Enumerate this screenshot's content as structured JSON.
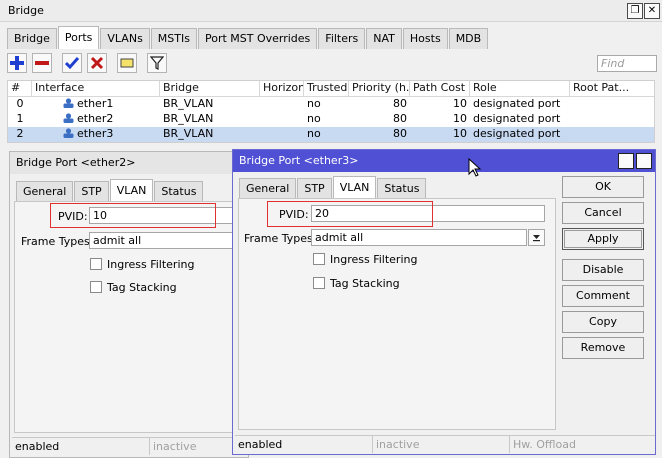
{
  "window": {
    "title": "Bridge",
    "restore_glyph": "❐",
    "close_glyph": "✕"
  },
  "main_tabs": [
    "Bridge",
    "Ports",
    "VLANs",
    "MSTIs",
    "Port MST Overrides",
    "Filters",
    "NAT",
    "Hosts",
    "MDB"
  ],
  "active_main_tab": "Ports",
  "toolbar": {
    "find_placeholder": "Find"
  },
  "table": {
    "headers": [
      "#",
      "Interface",
      "Bridge",
      "Horizon",
      "Trusted",
      "Priority (h...",
      "Path Cost",
      "Role",
      "Root Pat..."
    ],
    "rows": [
      {
        "num": "0",
        "iface": "ether1",
        "bridge": "BR_VLAN",
        "horizon": "",
        "trusted": "no",
        "priority": "80",
        "cost": "10",
        "role": "designated port",
        "root": ""
      },
      {
        "num": "1",
        "iface": "ether2",
        "bridge": "BR_VLAN",
        "horizon": "",
        "trusted": "no",
        "priority": "80",
        "cost": "10",
        "role": "designated port",
        "root": ""
      },
      {
        "num": "2",
        "iface": "ether3",
        "bridge": "BR_VLAN",
        "horizon": "",
        "trusted": "no",
        "priority": "80",
        "cost": "10",
        "role": "designated port",
        "root": ""
      }
    ],
    "selected_row": 2
  },
  "dialog_ether2": {
    "title": "Bridge Port <ether2>",
    "tabs": [
      "General",
      "STP",
      "VLAN",
      "Status"
    ],
    "active_tab": "VLAN",
    "pvid_label": "PVID:",
    "pvid_value": "10",
    "frame_types_label": "Frame Types:",
    "frame_types_value": "admit all",
    "ingress_label": "Ingress Filtering",
    "tag_stacking_label": "Tag Stacking",
    "status_left": "enabled",
    "status_mid": "inactive"
  },
  "dialog_ether3": {
    "title": "Bridge Port <ether3>",
    "tabs": [
      "General",
      "STP",
      "VLAN",
      "Status"
    ],
    "active_tab": "VLAN",
    "pvid_label": "PVID:",
    "pvid_value": "20",
    "frame_types_label": "Frame Types:",
    "frame_types_value": "admit all",
    "ingress_label": "Ingress Filtering",
    "tag_stacking_label": "Tag Stacking",
    "buttons": [
      "OK",
      "Cancel",
      "Apply",
      "Disable",
      "Comment",
      "Copy",
      "Remove"
    ],
    "status_left": "enabled",
    "status_mid": "inactive",
    "status_right": "Hw. Offload"
  },
  "colors": {
    "accent_title": "#5050d4",
    "selection": "#c8d9f2",
    "highlight_box": "#e03030",
    "add_icon": "#1e3fcf",
    "remove_icon": "#c01818"
  }
}
